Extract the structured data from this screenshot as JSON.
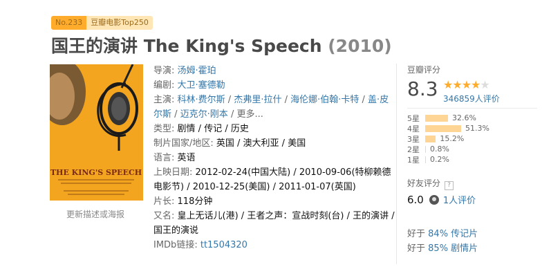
{
  "badge": {
    "rank": "No.233",
    "list": "豆瓣电影Top250"
  },
  "title": {
    "main": "国王的演讲 The King's Speech",
    "year": "(2010)"
  },
  "poster": {
    "title": "THE KING'S SPEECH",
    "caption": "更新描述或海报"
  },
  "info": {
    "director_label": "导演",
    "director": "汤姆·霍珀",
    "writer_label": "编剧",
    "writer": "大卫·塞德勒",
    "cast_label": "主演",
    "cast": [
      "科林·费尔斯",
      "杰弗里·拉什",
      "海伦娜·伯翰·卡特",
      "盖·皮尔斯",
      "迈克尔·刚本"
    ],
    "cast_more": "更多...",
    "genre_label": "类型",
    "genres": [
      "剧情",
      "传记",
      "历史"
    ],
    "country_label": "制片国家/地区",
    "country": "英国 / 澳大利亚 / 美国",
    "language_label": "语言",
    "language": "英语",
    "release_label": "上映日期",
    "releases": [
      "2012-02-24(中国大陆)",
      "2010-09-06(特柳赖德电影节)",
      "2010-12-25(美国)",
      "2011-01-07(英国)"
    ],
    "runtime_label": "片长",
    "runtime": "118分钟",
    "aka_label": "又名",
    "aka": "皇上无话儿(港) / 王者之声：宣战时刻(台) / 王的演讲 / 国王的演说",
    "imdb_label": "IMDb链接",
    "imdb": "tt1504320"
  },
  "rating": {
    "label": "豆瓣评分",
    "score": "8.3",
    "stars_filled": 4,
    "stars_total": 5,
    "count": "346859人评价",
    "distribution": [
      {
        "label": "5星",
        "pct": "32.6%",
        "value": 32.6
      },
      {
        "label": "4星",
        "pct": "51.3%",
        "value": 51.3
      },
      {
        "label": "3星",
        "pct": "15.2%",
        "value": 15.2
      },
      {
        "label": "2星",
        "pct": "0.8%",
        "value": 0.8
      },
      {
        "label": "1星",
        "pct": "0.2%",
        "value": 0.2
      }
    ]
  },
  "friends": {
    "label": "好友评分",
    "help": "?",
    "score": "6.0",
    "count": "1人评价"
  },
  "better_than": [
    {
      "prefix": "好于",
      "value": "84% 传记片"
    },
    {
      "prefix": "好于",
      "value": "85% 剧情片"
    }
  ],
  "colors": {
    "link": "#3377aa",
    "accent": "#ffac2d",
    "bar": "#ffd596"
  }
}
